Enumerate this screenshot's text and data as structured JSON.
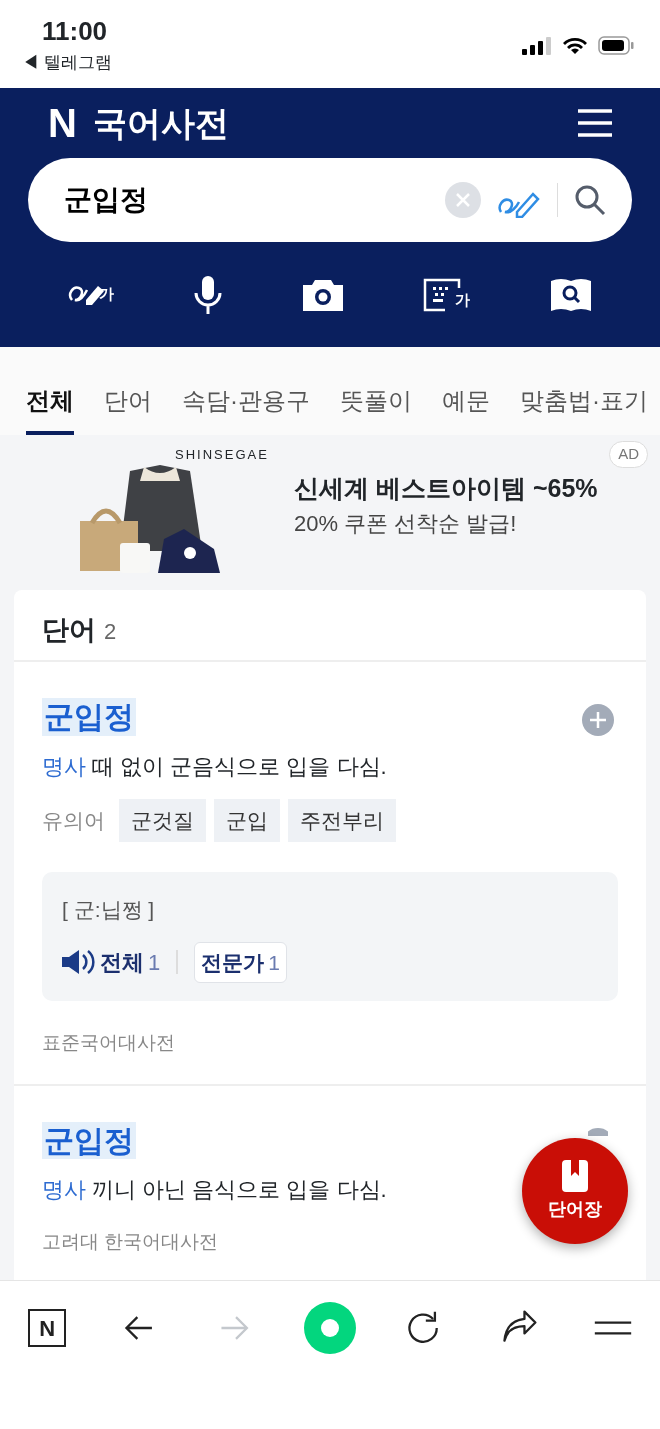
{
  "status_bar": {
    "time": "11:00",
    "back_app": "◀ 텔레그램"
  },
  "header": {
    "logo_letter": "N",
    "title": "국어사전",
    "search": {
      "value": "군입정"
    },
    "tools": [
      {
        "kind": "handwriting",
        "glyph": "가"
      },
      {
        "kind": "voice"
      },
      {
        "kind": "camera"
      },
      {
        "kind": "keyboard",
        "glyph": "가"
      },
      {
        "kind": "book-search"
      }
    ]
  },
  "tabs": [
    {
      "label": "전체",
      "selected": true
    },
    {
      "label": "단어",
      "selected": false
    },
    {
      "label": "속담·관용구",
      "selected": false
    },
    {
      "label": "뜻풀이",
      "selected": false
    },
    {
      "label": "예문",
      "selected": false
    },
    {
      "label": "맞춤법·표기",
      "selected": false
    }
  ],
  "ad": {
    "brand": "SHINSEGAE",
    "badge": "AD",
    "headline": "신세계 베스트아이템 ~65%",
    "subline": "20% 쿠폰 선착순 발급!"
  },
  "section": {
    "title": "단어",
    "count": "2",
    "entries": [
      {
        "headword": "군입정",
        "pos": "명사",
        "definition": "때 없이 군음식으로 입을 다심.",
        "synonyms_label": "유의어",
        "synonyms": [
          "군것질",
          "군입",
          "주전부리"
        ],
        "pronunciation": "[ 군:닙쩡 ]",
        "audio": {
          "label": "전체",
          "count": "1"
        },
        "expert": {
          "label": "전문가",
          "count": "1"
        },
        "source": "표준국어대사전"
      },
      {
        "headword": "군입정",
        "pos": "명사",
        "definition": "끼니 아닌 음식으로 입을 다심.",
        "source": "고려대 한국어대사전"
      }
    ]
  },
  "fab": {
    "label": "단어장"
  },
  "bottom_nav": [
    {
      "kind": "home",
      "glyph": "N",
      "disabled": false
    },
    {
      "kind": "back",
      "disabled": false
    },
    {
      "kind": "forward",
      "disabled": true
    },
    {
      "kind": "green-dot",
      "disabled": false
    },
    {
      "kind": "reload",
      "disabled": false
    },
    {
      "kind": "share",
      "disabled": false
    },
    {
      "kind": "menu",
      "disabled": false
    }
  ]
}
